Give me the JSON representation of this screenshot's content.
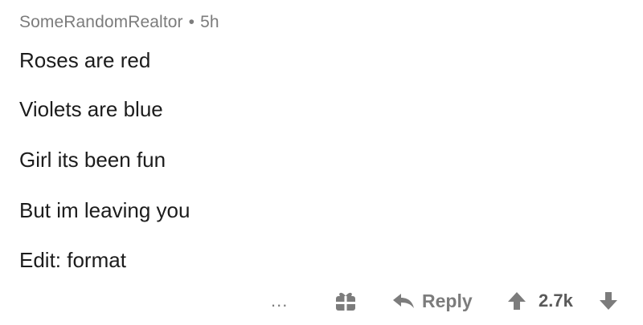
{
  "comment": {
    "author": "SomeRandomRealtor",
    "separator": "•",
    "time": "5h",
    "lines": [
      "Roses are red",
      "Violets are blue",
      "Girl its been fun",
      "But im leaving you",
      "Edit: format"
    ]
  },
  "actions": {
    "more_label": "...",
    "award_icon": "gift-icon",
    "reply_label": "Reply",
    "reply_icon": "reply-arrow-icon",
    "upvote_icon": "upvote-arrow-icon",
    "score": "2.7k",
    "downvote_icon": "downvote-arrow-icon"
  },
  "colors": {
    "text": "#1c1c1c",
    "meta": "#7c7c7c",
    "icon": "#7c7c7c"
  }
}
